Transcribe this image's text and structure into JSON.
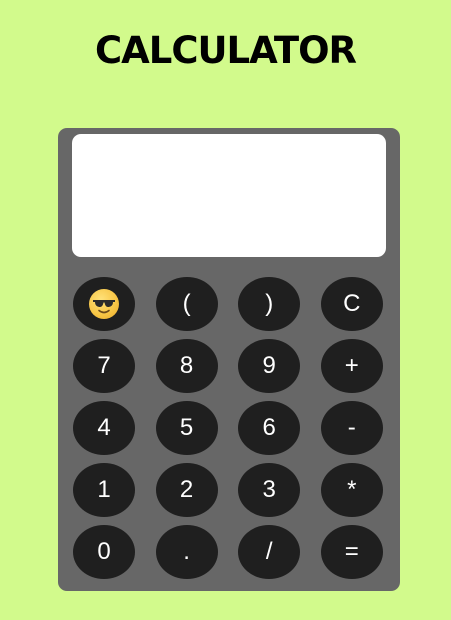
{
  "title": "CALCULATOR",
  "display": {
    "value": ""
  },
  "keys": [
    {
      "label": "",
      "icon": "sunglasses-emoji-icon",
      "name": "emoji-button"
    },
    {
      "label": "(",
      "name": "open-paren-button"
    },
    {
      "label": ")",
      "name": "close-paren-button"
    },
    {
      "label": "C",
      "name": "clear-button"
    },
    {
      "label": "7",
      "name": "digit-7-button"
    },
    {
      "label": "8",
      "name": "digit-8-button"
    },
    {
      "label": "9",
      "name": "digit-9-button"
    },
    {
      "label": "+",
      "name": "plus-button"
    },
    {
      "label": "4",
      "name": "digit-4-button"
    },
    {
      "label": "5",
      "name": "digit-5-button"
    },
    {
      "label": "6",
      "name": "digit-6-button"
    },
    {
      "label": "-",
      "name": "minus-button"
    },
    {
      "label": "1",
      "name": "digit-1-button"
    },
    {
      "label": "2",
      "name": "digit-2-button"
    },
    {
      "label": "3",
      "name": "digit-3-button"
    },
    {
      "label": "*",
      "name": "multiply-button"
    },
    {
      "label": "0",
      "name": "digit-0-button"
    },
    {
      "label": ".",
      "name": "decimal-button"
    },
    {
      "label": "/",
      "name": "divide-button"
    },
    {
      "label": "=",
      "name": "equals-button"
    }
  ],
  "colors": {
    "page_background": "#d2fa8c",
    "calculator_body": "#676767",
    "display_background": "#ffffff",
    "key_background": "#1f1f1f",
    "key_text": "#ffffff"
  }
}
